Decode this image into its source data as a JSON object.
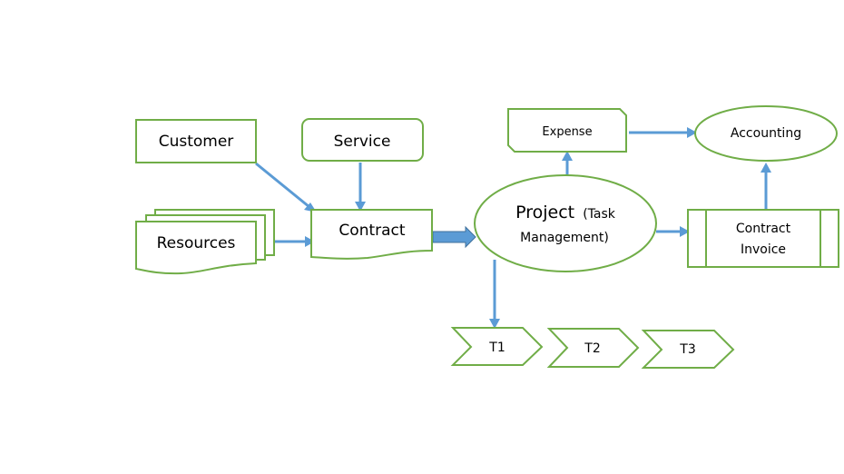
{
  "nodes": {
    "customer": "Customer",
    "service": "Service",
    "resources": "Resources",
    "contract": "Contract",
    "project": "Project",
    "project_sub1": "(Task",
    "project_sub2": "Management)",
    "expense": "Expense",
    "accounting": "Accounting",
    "invoice_line1": "Contract",
    "invoice_line2": "Invoice",
    "t1": "T1",
    "t2": "T2",
    "t3": "T3"
  },
  "edges": [
    {
      "from": "Customer",
      "to": "Contract"
    },
    {
      "from": "Service",
      "to": "Contract"
    },
    {
      "from": "Resources",
      "to": "Contract"
    },
    {
      "from": "Contract",
      "to": "Project"
    },
    {
      "from": "Project",
      "to": "Expense"
    },
    {
      "from": "Expense",
      "to": "Accounting"
    },
    {
      "from": "Project",
      "to": "Contract Invoice"
    },
    {
      "from": "Contract Invoice",
      "to": "Accounting"
    },
    {
      "from": "Project",
      "to": "T1"
    }
  ],
  "colors": {
    "shape_stroke": "#70ad47",
    "connector": "#5b9bd5"
  }
}
